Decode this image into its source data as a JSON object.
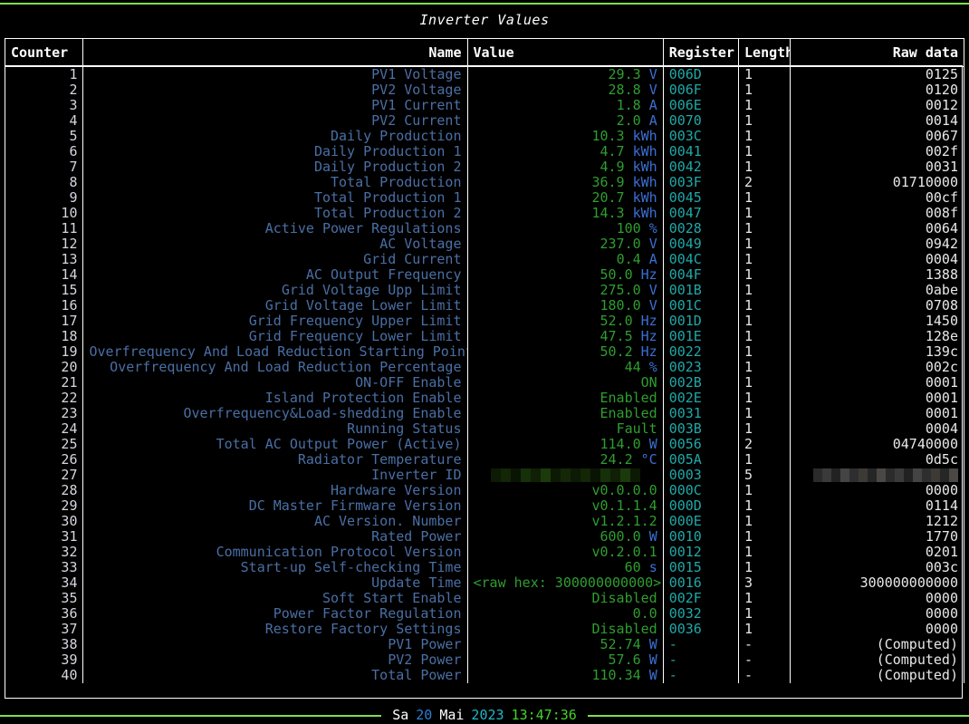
{
  "window": {
    "title": "Inverter Values"
  },
  "table": {
    "columns": [
      {
        "key": "counter",
        "label": "Counter"
      },
      {
        "key": "name",
        "label": "Name"
      },
      {
        "key": "value",
        "label": "Value"
      },
      {
        "key": "register",
        "label": "Register"
      },
      {
        "key": "length",
        "label": "Length"
      },
      {
        "key": "raw",
        "label": "Raw data"
      }
    ],
    "rows": [
      {
        "counter": "1",
        "name": "PV1 Voltage",
        "value": "29.3",
        "unit": "V",
        "register": "006D",
        "length": "1",
        "raw": "0125"
      },
      {
        "counter": "2",
        "name": "PV2 Voltage",
        "value": "28.8",
        "unit": "V",
        "register": "006F",
        "length": "1",
        "raw": "0120"
      },
      {
        "counter": "3",
        "name": "PV1 Current",
        "value": "1.8",
        "unit": "A",
        "register": "006E",
        "length": "1",
        "raw": "0012"
      },
      {
        "counter": "4",
        "name": "PV2 Current",
        "value": "2.0",
        "unit": "A",
        "register": "0070",
        "length": "1",
        "raw": "0014"
      },
      {
        "counter": "5",
        "name": "Daily Production",
        "value": "10.3",
        "unit": "kWh",
        "register": "003C",
        "length": "1",
        "raw": "0067"
      },
      {
        "counter": "6",
        "name": "Daily Production 1",
        "value": "4.7",
        "unit": "kWh",
        "register": "0041",
        "length": "1",
        "raw": "002f"
      },
      {
        "counter": "7",
        "name": "Daily Production 2",
        "value": "4.9",
        "unit": "kWh",
        "register": "0042",
        "length": "1",
        "raw": "0031"
      },
      {
        "counter": "8",
        "name": "Total Production",
        "value": "36.9",
        "unit": "kWh",
        "register": "003F",
        "length": "2",
        "raw": "01710000"
      },
      {
        "counter": "9",
        "name": "Total Production 1",
        "value": "20.7",
        "unit": "kWh",
        "register": "0045",
        "length": "1",
        "raw": "00cf"
      },
      {
        "counter": "10",
        "name": "Total Production 2",
        "value": "14.3",
        "unit": "kWh",
        "register": "0047",
        "length": "1",
        "raw": "008f"
      },
      {
        "counter": "11",
        "name": "Active Power Regulations",
        "value": "100",
        "unit": "%",
        "register": "0028",
        "length": "1",
        "raw": "0064"
      },
      {
        "counter": "12",
        "name": "AC Voltage",
        "value": "237.0",
        "unit": "V",
        "register": "0049",
        "length": "1",
        "raw": "0942"
      },
      {
        "counter": "13",
        "name": "Grid Current",
        "value": "0.4",
        "unit": "A",
        "register": "004C",
        "length": "1",
        "raw": "0004"
      },
      {
        "counter": "14",
        "name": "AC Output Frequency",
        "value": "50.0",
        "unit": "Hz",
        "register": "004F",
        "length": "1",
        "raw": "1388"
      },
      {
        "counter": "15",
        "name": "Grid Voltage Upp Limit",
        "value": "275.0",
        "unit": "V",
        "register": "001B",
        "length": "1",
        "raw": "0abe"
      },
      {
        "counter": "16",
        "name": "Grid Voltage Lower Limit",
        "value": "180.0",
        "unit": "V",
        "register": "001C",
        "length": "1",
        "raw": "0708"
      },
      {
        "counter": "17",
        "name": "Grid Frequency Upper Limit",
        "value": "52.0",
        "unit": "Hz",
        "register": "001D",
        "length": "1",
        "raw": "1450"
      },
      {
        "counter": "18",
        "name": "Grid Frequency Lower Limit",
        "value": "47.5",
        "unit": "Hz",
        "register": "001E",
        "length": "1",
        "raw": "128e"
      },
      {
        "counter": "19",
        "name": "Overfrequency And Load Reduction Starting Point",
        "value": "50.2",
        "unit": "Hz",
        "register": "0022",
        "length": "1",
        "raw": "139c"
      },
      {
        "counter": "20",
        "name": "Overfrequency And Load Reduction Percentage",
        "value": "44",
        "unit": "%",
        "register": "0023",
        "length": "1",
        "raw": "002c"
      },
      {
        "counter": "21",
        "name": "ON-OFF Enable",
        "value": "ON",
        "unit": "",
        "register": "002B",
        "length": "1",
        "raw": "0001"
      },
      {
        "counter": "22",
        "name": "Island Protection Enable",
        "value": "Enabled",
        "unit": "",
        "register": "002E",
        "length": "1",
        "raw": "0001"
      },
      {
        "counter": "23",
        "name": "Overfrequency&Load-shedding Enable",
        "value": "Enabled",
        "unit": "",
        "register": "0031",
        "length": "1",
        "raw": "0001"
      },
      {
        "counter": "24",
        "name": "Running Status",
        "value": "Fault",
        "unit": "",
        "register": "003B",
        "length": "1",
        "raw": "0004"
      },
      {
        "counter": "25",
        "name": "Total AC Output Power (Active)",
        "value": "114.0",
        "unit": "W",
        "register": "0056",
        "length": "2",
        "raw": "04740000"
      },
      {
        "counter": "26",
        "name": "Radiator Temperature",
        "value": "24.2",
        "unit": "°C",
        "register": "005A",
        "length": "1",
        "raw": "0d5c"
      },
      {
        "counter": "27",
        "name": "Inverter ID",
        "value": "",
        "unit": "",
        "register": "0003",
        "length": "5",
        "raw": "",
        "value_redacted": true,
        "raw_redacted": true
      },
      {
        "counter": "28",
        "name": "Hardware Version",
        "value": "v0.0.0.0",
        "unit": "",
        "register": "000C",
        "length": "1",
        "raw": "0000"
      },
      {
        "counter": "29",
        "name": "DC Master Firmware Version",
        "value": "v0.1.1.4",
        "unit": "",
        "register": "000D",
        "length": "1",
        "raw": "0114"
      },
      {
        "counter": "30",
        "name": "AC Version. Number",
        "value": "v1.2.1.2",
        "unit": "",
        "register": "000E",
        "length": "1",
        "raw": "1212"
      },
      {
        "counter": "31",
        "name": "Rated Power",
        "value": "600.0",
        "unit": "W",
        "register": "0010",
        "length": "1",
        "raw": "1770"
      },
      {
        "counter": "32",
        "name": "Communication Protocol Version",
        "value": "v0.2.0.1",
        "unit": "",
        "register": "0012",
        "length": "1",
        "raw": "0201"
      },
      {
        "counter": "33",
        "name": "Start-up Self-checking Time",
        "value": "60",
        "unit": "s",
        "register": "0015",
        "length": "1",
        "raw": "003c"
      },
      {
        "counter": "34",
        "name": "Update Time",
        "value": "<raw hex: 300000000000>",
        "unit": "",
        "register": "0016",
        "length": "3",
        "raw": "300000000000"
      },
      {
        "counter": "35",
        "name": "Soft Start Enable",
        "value": "Disabled",
        "unit": "",
        "register": "002F",
        "length": "1",
        "raw": "0000"
      },
      {
        "counter": "36",
        "name": "Power Factor Regulation",
        "value": "0.0",
        "unit": "",
        "register": "0032",
        "length": "1",
        "raw": "0000"
      },
      {
        "counter": "37",
        "name": "Restore Factory Settings",
        "value": "Disabled",
        "unit": "",
        "register": "0036",
        "length": "1",
        "raw": "0000"
      },
      {
        "counter": "38",
        "name": "PV1 Power",
        "value": "52.74",
        "unit": "W",
        "register": "-",
        "length": "-",
        "raw": "(Computed)"
      },
      {
        "counter": "39",
        "name": "PV2 Power",
        "value": "57.6",
        "unit": "W",
        "register": "-",
        "length": "-",
        "raw": "(Computed)"
      },
      {
        "counter": "40",
        "name": "Total Power",
        "value": "110.34",
        "unit": "W",
        "register": "-",
        "length": "-",
        "raw": "(Computed)"
      }
    ]
  },
  "statusbar": {
    "weekday": "Sa",
    "day": "20",
    "month": "Mai",
    "year": "2023",
    "time": "13:47:36"
  },
  "colors": {
    "accent_green": "#7ddf4f",
    "value_green": "#2f9e2f",
    "unit_blue": "#3b6fd4",
    "name_blue": "#4a6fa5",
    "register_teal": "#1fa8a8",
    "background": "#000000"
  }
}
